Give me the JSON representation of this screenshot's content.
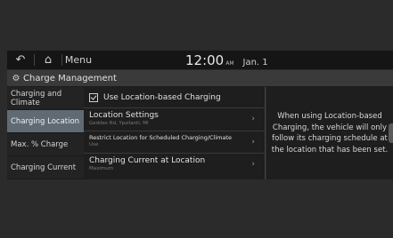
{
  "status_bar": {
    "back_icon": "↶",
    "home_icon": "⌂",
    "menu_label": "Menu",
    "time": "12:00",
    "ampm": "AM",
    "date": "Jan. 1"
  },
  "title_bar": {
    "icon": "gear-icon",
    "title": "Charge Management"
  },
  "sidebar": {
    "items": [
      {
        "label": "Charging and Climate",
        "active": false
      },
      {
        "label": "Charging Location",
        "active": true
      },
      {
        "label": "Max. % Charge",
        "active": false
      },
      {
        "label": "Charging Current",
        "active": false
      }
    ]
  },
  "main": {
    "use_location": {
      "label": "Use Location-based Charging",
      "checked": true
    },
    "location_settings": {
      "title": "Location Settings",
      "sub": "Geddes Rd, Ypsilanti, MI"
    },
    "restrict": {
      "title": "Restrict Location for Scheduled Charging/Climate",
      "sub": "Use"
    },
    "current_at_location": {
      "title": "Charging Current at Location",
      "sub": "Maximum"
    }
  },
  "info": {
    "text": "When using Location-based Charging, the vehicle will only follow its charging schedule at the location that has been set."
  }
}
